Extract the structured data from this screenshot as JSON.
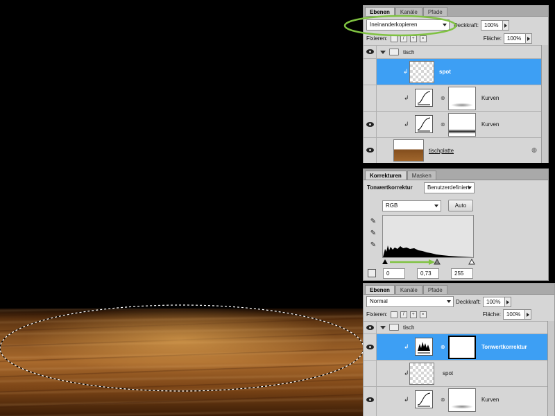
{
  "layers_panel_top": {
    "tabs": [
      "Ebenen",
      "Kanäle",
      "Pfade"
    ],
    "active_tab": "Ebenen",
    "blend_mode": "Ineinanderkopieren",
    "opacity_label": "Deckkraft:",
    "opacity_value": "100%",
    "lock_label": "Fixieren:",
    "fill_label": "Fläche:",
    "fill_value": "100%",
    "highlight_color": "#7fc241",
    "layers": [
      {
        "name": "tisch",
        "kind": "group"
      },
      {
        "name": "spot",
        "kind": "pixel",
        "selected": true
      },
      {
        "name": "Kurven",
        "kind": "curves"
      },
      {
        "name": "Kurven",
        "kind": "curves"
      },
      {
        "name": "tischplatte",
        "kind": "pixel"
      }
    ]
  },
  "adjustments_panel": {
    "tabs": [
      "Korrekturen",
      "Masken"
    ],
    "active_tab": "Korrekturen",
    "title": "Tonwertkorrektur",
    "preset": "Benutzerdefiniert",
    "channel": "RGB",
    "auto_label": "Auto",
    "input_black": "0",
    "input_gamma": "0,73",
    "input_white": "255",
    "arrow_color": "#7fc241"
  },
  "layers_panel_bottom": {
    "tabs": [
      "Ebenen",
      "Kanäle",
      "Pfade"
    ],
    "active_tab": "Ebenen",
    "blend_mode": "Normal",
    "opacity_label": "Deckkraft:",
    "opacity_value": "100%",
    "lock_label": "Fixieren:",
    "fill_label": "Fläche:",
    "fill_value": "100%",
    "layers": [
      {
        "name": "tisch",
        "kind": "group"
      },
      {
        "name": "Tonwertkorrektur",
        "kind": "levels",
        "selected": true
      },
      {
        "name": "spot",
        "kind": "pixel"
      },
      {
        "name": "Kurven",
        "kind": "curves"
      }
    ]
  }
}
